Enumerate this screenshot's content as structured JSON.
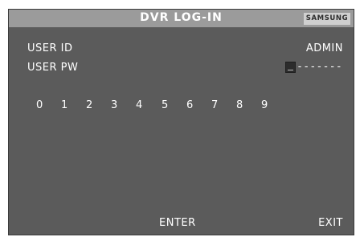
{
  "window": {
    "title": "DVR LOG-IN",
    "brand": "SAMSUNG"
  },
  "fields": {
    "user_id_label": "USER ID",
    "user_id_value": "ADMIN",
    "user_pw_label": "USER PW",
    "user_pw_value": "-------"
  },
  "keypad": {
    "digits": [
      "0",
      "1",
      "2",
      "3",
      "4",
      "5",
      "6",
      "7",
      "8",
      "9"
    ]
  },
  "footer": {
    "enter_label": "ENTER",
    "exit_label": "EXIT"
  },
  "colors": {
    "panel": "#5b5b5b",
    "title_bar": "#9b9b9b",
    "text": "#ffffff"
  }
}
